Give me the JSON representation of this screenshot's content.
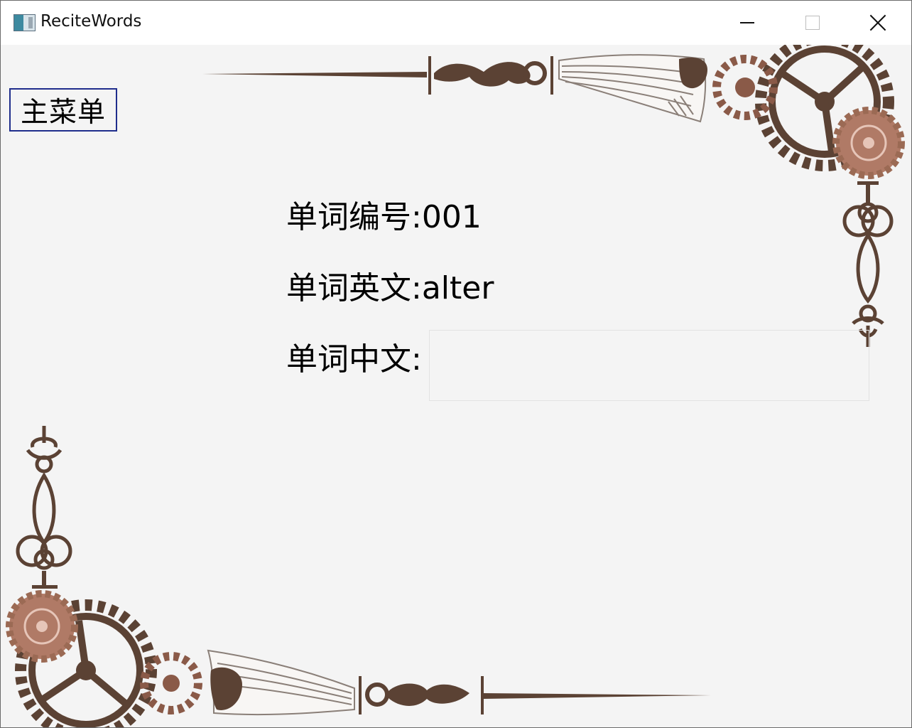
{
  "window": {
    "title": "ReciteWords",
    "icon": "app-icon",
    "controls": [
      "minimize-icon",
      "maximize-icon",
      "close-icon"
    ]
  },
  "toolbar": {
    "menu_label": "主菜单"
  },
  "word": {
    "number_label": "单词编号:",
    "number_value": "001",
    "english_label": "单词英文:",
    "english_value": "alter",
    "chinese_label": "单词中文:",
    "chinese_value": "",
    "chinese_placeholder": ""
  },
  "colors": {
    "ornament_brown": "#5b4234",
    "gear_copper": "#9b6a54",
    "menu_border": "#1f2d8c",
    "background": "#f4f4f4"
  }
}
